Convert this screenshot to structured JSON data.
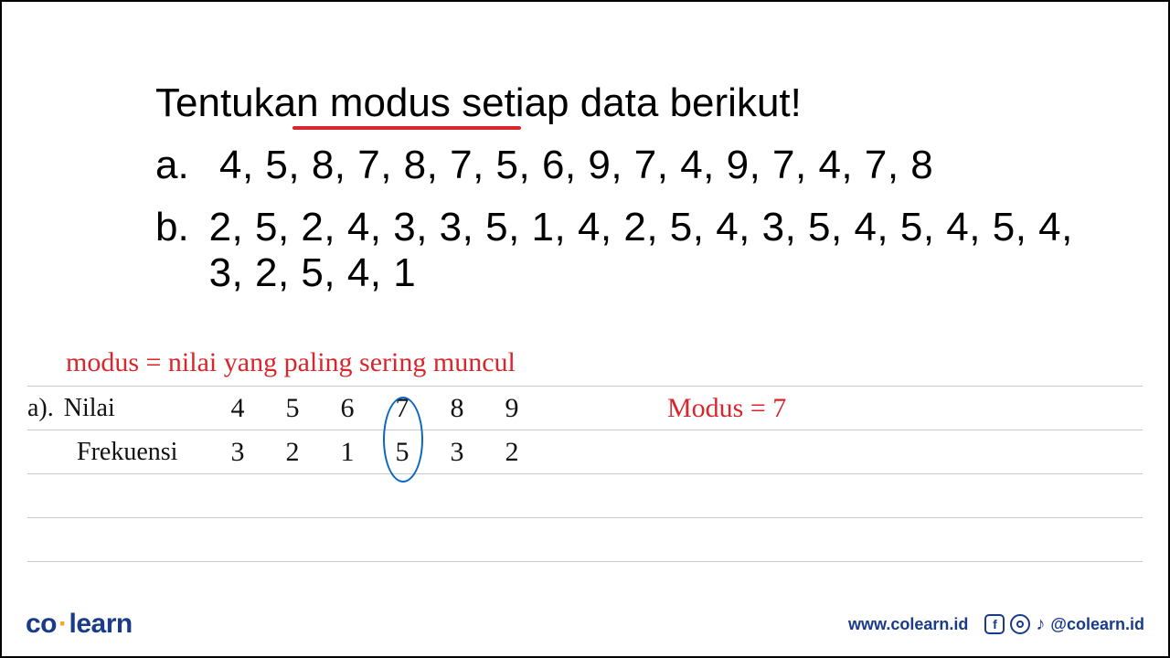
{
  "problem": {
    "title": "Tentukan modus setiap data berikut!",
    "items": [
      {
        "label": "a.",
        "data": "4, 5, 8, 7, 8, 7, 5, 6, 9, 7, 4, 9, 7, 4, 7, 8"
      },
      {
        "label": "b.",
        "data": "2, 5, 2, 4, 3, 3, 5, 1, 4, 2, 5, 4, 3, 5, 4, 5, 4, 5, 4, 3, 2, 5, 4, 1"
      }
    ]
  },
  "work": {
    "definition": "modus = nilai  yang  paling  sering  muncul",
    "part_a": {
      "prefix": "a).",
      "row1_label": "Nilai",
      "row2_label": "Frekuensi",
      "values": [
        "4",
        "5",
        "6",
        "7",
        "8",
        "9"
      ],
      "frequencies": [
        "3",
        "2",
        "1",
        "5",
        "3",
        "2"
      ],
      "circled_index": 3,
      "answer": "Modus  =  7"
    }
  },
  "footer": {
    "logo_left": "co",
    "logo_right": "learn",
    "url": "www.colearn.id",
    "handle": "@colearn.id"
  },
  "chart_data": {
    "type": "table",
    "title": "Frequency table for data set (a)",
    "columns": [
      "Nilai",
      "Frekuensi"
    ],
    "rows": [
      {
        "Nilai": 4,
        "Frekuensi": 3
      },
      {
        "Nilai": 5,
        "Frekuensi": 2
      },
      {
        "Nilai": 6,
        "Frekuensi": 1
      },
      {
        "Nilai": 7,
        "Frekuensi": 5
      },
      {
        "Nilai": 8,
        "Frekuensi": 3
      },
      {
        "Nilai": 9,
        "Frekuensi": 2
      }
    ],
    "mode": 7
  }
}
